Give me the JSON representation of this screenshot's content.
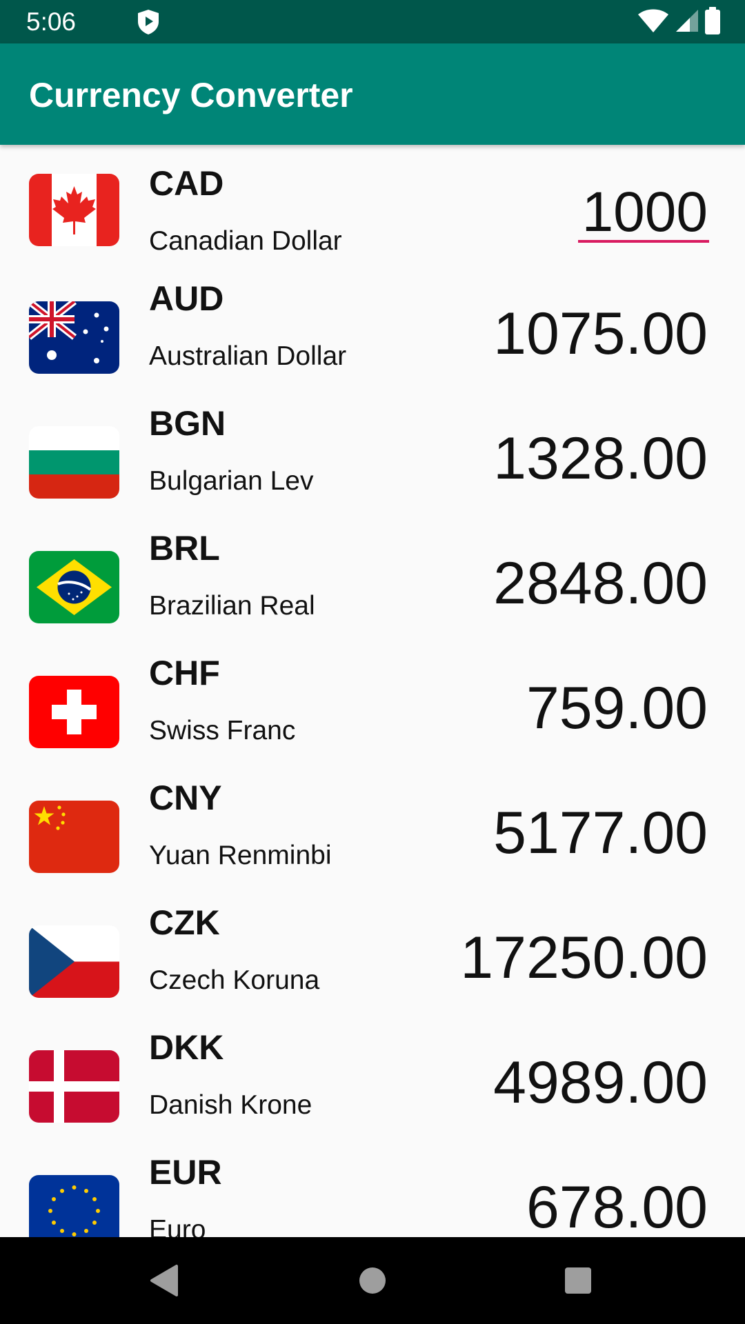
{
  "status_bar": {
    "time": "5:06"
  },
  "app_bar": {
    "title": "Currency Converter"
  },
  "currencies": [
    {
      "code": "CAD",
      "name": "Canadian Dollar",
      "value": "1000"
    },
    {
      "code": "AUD",
      "name": "Australian Dollar",
      "value": "1075.00"
    },
    {
      "code": "BGN",
      "name": "Bulgarian Lev",
      "value": "1328.00"
    },
    {
      "code": "BRL",
      "name": "Brazilian Real",
      "value": "2848.00"
    },
    {
      "code": "CHF",
      "name": "Swiss Franc",
      "value": "759.00"
    },
    {
      "code": "CNY",
      "name": "Yuan Renminbi",
      "value": "5177.00"
    },
    {
      "code": "CZK",
      "name": "Czech Koruna",
      "value": "17250.00"
    },
    {
      "code": "DKK",
      "name": "Danish Krone",
      "value": "4989.00"
    },
    {
      "code": "EUR",
      "name": "Euro",
      "value": "678.00"
    }
  ],
  "colors": {
    "status_bar": "#00574b",
    "app_bar": "#008577",
    "accent": "#d81b60",
    "background": "#fafafa"
  },
  "icons": {
    "status": [
      "shield-icon",
      "wifi-icon",
      "cell-signal-icon",
      "battery-icon"
    ],
    "navigation": [
      "back-icon",
      "home-icon",
      "recents-icon"
    ]
  }
}
